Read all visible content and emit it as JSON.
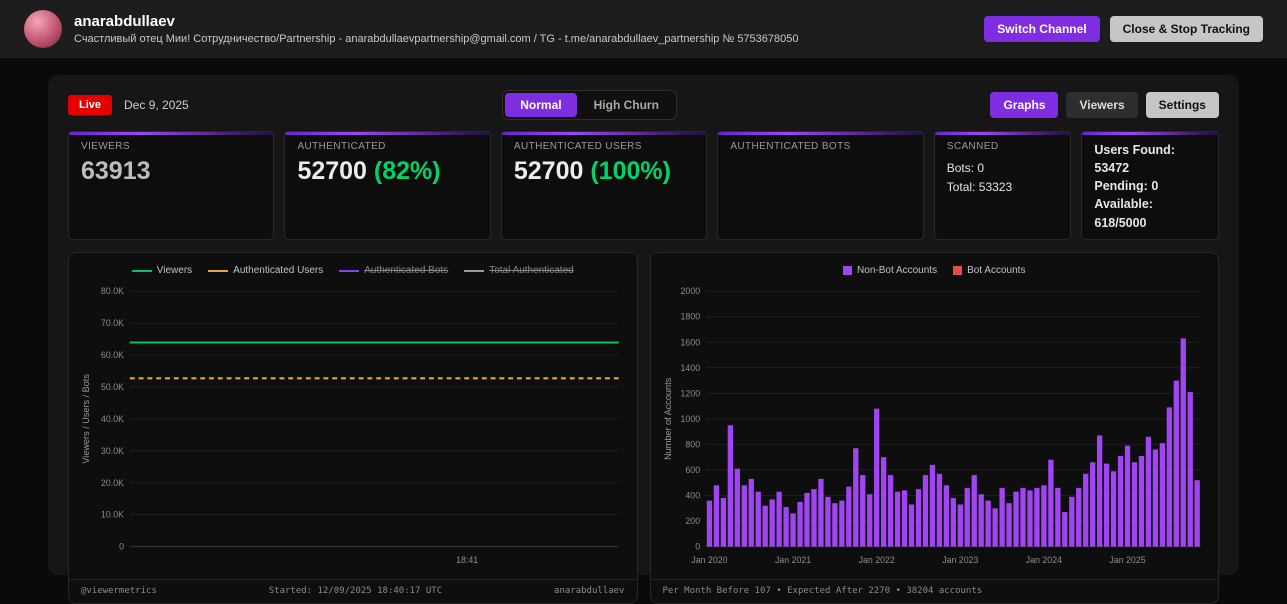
{
  "header": {
    "username": "anarabdullaev",
    "subtitle": "Счастливый отец Мии! Сотрудничество/Partnership - anarabdullaevpartnership@gmail.com / TG - t.me/anarabdullaev_partnership № 5753678050",
    "switch_channel_label": "Switch Channel",
    "close_label": "Close & Stop Tracking"
  },
  "toolbar": {
    "live_label": "Live",
    "date": "Dec 9, 2025",
    "mode_options": [
      "Normal",
      "High Churn"
    ],
    "mode_selected": "Normal",
    "graphs_label": "Graphs",
    "viewers_label": "Viewers",
    "settings_label": "Settings"
  },
  "stats": {
    "viewers": {
      "label": "VIEWERS",
      "value": "63913"
    },
    "authenticated": {
      "label": "AUTHENTICATED",
      "value": "52700",
      "percent": "(82%)"
    },
    "authenticated_users": {
      "label": "AUTHENTICATED USERS",
      "value": "52700",
      "percent": "(100%)"
    },
    "authenticated_bots": {
      "label": "AUTHENTICATED BOTS",
      "value": ""
    },
    "scanned": {
      "label": "SCANNED",
      "bots": "Bots: 0",
      "total": "Total: 53323"
    },
    "found": {
      "users": "Users Found: 53472",
      "pending": "Pending: 0",
      "available": "Available: 618/5000"
    }
  },
  "left_panel": {
    "footer_left": "@viewermetrics",
    "footer_center": "Started: 12/09/2025 18:40:17 UTC",
    "footer_right": "anarabdullaev"
  },
  "right_panel": {
    "footer_left": "Per Month Before 107 • Expected After 2270 • 38204 accounts"
  },
  "colors": {
    "accent_purple": "#7e2ee0",
    "live_red": "#e50000",
    "percent_green": "#00d26a"
  },
  "chart_data": [
    {
      "type": "line",
      "ylabel": "Viewers / Users / Bots",
      "ylim": [
        0,
        80000
      ],
      "yticks": [
        "0",
        "10.0K",
        "20.0K",
        "30.0K",
        "40.0K",
        "50.0K",
        "60.0K",
        "70.0K",
        "80.0K"
      ],
      "x_ticks": [
        "18:41"
      ],
      "x_tick_pos": 0.69,
      "grid": true,
      "legend_position": "top",
      "series": [
        {
          "name": "Viewers",
          "color": "#00c46a",
          "style": "solid",
          "value": 63913,
          "enabled": true
        },
        {
          "name": "Authenticated Users",
          "color": "#e8a33d",
          "style": "dashed",
          "value": 52700,
          "enabled": true
        },
        {
          "name": "Authenticated Bots",
          "color": "#8a3ff0",
          "style": "dashed",
          "value": 0,
          "enabled": false
        },
        {
          "name": "Total Authenticated",
          "color": "#9a9a9a",
          "style": "solid",
          "value": 0,
          "enabled": false
        }
      ]
    },
    {
      "type": "bar",
      "ylabel": "Number of Accounts",
      "ylim": [
        0,
        2000
      ],
      "yticks": [
        "0",
        "200",
        "400",
        "600",
        "800",
        "1000",
        "1200",
        "1400",
        "1600",
        "1800",
        "2000"
      ],
      "x_tick_labels": [
        "Jan 2020",
        "Jan 2021",
        "Jan 2022",
        "Jan 2023",
        "Jan 2024",
        "Jan 2025"
      ],
      "x_tick_idx": [
        0,
        12,
        24,
        36,
        48,
        60
      ],
      "grid": true,
      "legend_position": "top",
      "legend": [
        {
          "name": "Non-Bot Accounts",
          "color": "#a144f2"
        },
        {
          "name": "Bot Accounts",
          "color": "#e54b4b"
        }
      ],
      "values": [
        360,
        480,
        380,
        950,
        610,
        480,
        530,
        430,
        320,
        370,
        430,
        310,
        260,
        350,
        420,
        450,
        530,
        390,
        340,
        360,
        470,
        770,
        560,
        410,
        1080,
        700,
        560,
        430,
        440,
        330,
        450,
        560,
        640,
        570,
        480,
        380,
        330,
        460,
        560,
        410,
        360,
        300,
        460,
        340,
        430,
        460,
        440,
        460,
        480,
        680,
        460,
        270,
        390,
        460,
        570,
        660,
        870,
        650,
        590,
        710,
        790,
        660,
        710,
        860,
        760,
        810,
        1090,
        1300,
        1630,
        1210,
        520
      ]
    }
  ]
}
